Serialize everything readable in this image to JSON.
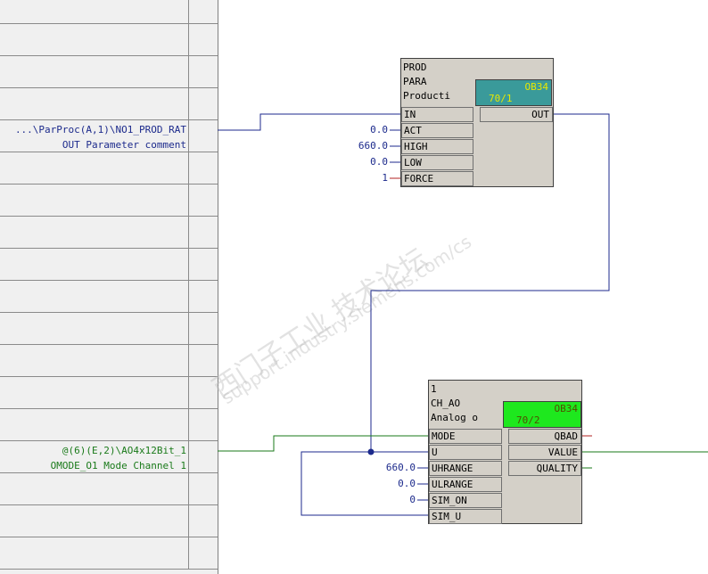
{
  "sheet_bar": {
    "ref1_line1": "...\\ParProc(A,1)\\NO1_PROD_RAT",
    "ref1_line2": "OUT Parameter comment",
    "ref2_line1": "@(6)(E,2)\\AO4x12Bit_1",
    "ref2_line2": "OMODE_O1 Mode Channel 1"
  },
  "block_prod": {
    "header": [
      "PROD",
      "PARA",
      "Producti"
    ],
    "ob_line1": "OB34",
    "ob_line2": "70/1",
    "ob_color": "#3a9a9a",
    "inputs": [
      {
        "name": "IN",
        "value": ""
      },
      {
        "name": "ACT",
        "value": "0.0"
      },
      {
        "name": "HIGH",
        "value": "660.0"
      },
      {
        "name": "LOW",
        "value": "0.0"
      },
      {
        "name": "FORCE",
        "value": "1"
      }
    ],
    "outputs": [
      {
        "name": "OUT"
      }
    ]
  },
  "block_ch_ao": {
    "header": [
      "1",
      "CH_AO",
      "Analog o"
    ],
    "ob_line1": "OB34",
    "ob_line2": "70/2",
    "ob_color": "#1ee81e",
    "inputs": [
      {
        "name": "MODE",
        "value": ""
      },
      {
        "name": "U",
        "value": ""
      },
      {
        "name": "UHRANGE",
        "value": "660.0"
      },
      {
        "name": "ULRANGE",
        "value": "0.0"
      },
      {
        "name": "SIM_ON",
        "value": "0"
      },
      {
        "name": "SIM_U",
        "value": ""
      }
    ],
    "outputs": [
      {
        "name": "QBAD"
      },
      {
        "name": "VALUE"
      },
      {
        "name": "QUALITY"
      }
    ]
  },
  "watermark": {
    "line1": "西门子工业  技术论坛",
    "line2": "support.industry.siemens.com/cs"
  }
}
